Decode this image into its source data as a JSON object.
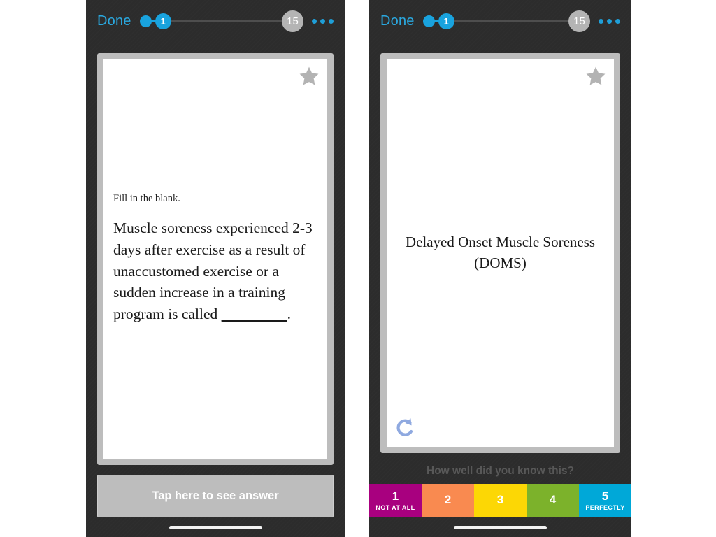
{
  "colors": {
    "panel_bg": "#2d2d2d",
    "accent_blue": "#19a3de",
    "done_blue": "#2aa8df",
    "card_border": "#bdbdbd",
    "tap_button_bg": "#bdbdbd",
    "star_gray": "#b3b3b3",
    "undo_blue": "#8fa9e0",
    "rating_1": "#a8007f",
    "rating_2": "#f98a50",
    "rating_3": "#fcd705",
    "rating_4": "#7cb22b",
    "rating_5": "#00a8d8"
  },
  "left_screen": {
    "topbar": {
      "done_label": "Done",
      "current_card": "1",
      "total_cards": "15",
      "more_icon": "ellipsis-icon"
    },
    "card": {
      "star_icon": "star-icon",
      "prompt": "Fill in the blank.",
      "question_before": "Muscle soreness experienced 2-3 days after exercise as a result of unaccustomed exercise or a sudden increase in a training program is called ",
      "question_blank": "________",
      "question_after": "."
    },
    "tap_button_label": "Tap here to see answer"
  },
  "right_screen": {
    "topbar": {
      "done_label": "Done",
      "current_card": "1",
      "total_cards": "15",
      "more_icon": "ellipsis-icon"
    },
    "card": {
      "star_icon": "star-icon",
      "undo_icon": "undo-arrow-icon",
      "answer_line_1": "Delayed Onset Muscle Soreness",
      "answer_line_2": "(DOMS)"
    },
    "rating": {
      "prompt": "How well did you know this?",
      "buttons": [
        {
          "number": "1",
          "sublabel": "NOT AT ALL",
          "color": "#a8007f"
        },
        {
          "number": "2",
          "sublabel": "",
          "color": "#f98a50"
        },
        {
          "number": "3",
          "sublabel": "",
          "color": "#fcd705"
        },
        {
          "number": "4",
          "sublabel": "",
          "color": "#7cb22b"
        },
        {
          "number": "5",
          "sublabel": "PERFECTLY",
          "color": "#00a8d8"
        }
      ]
    }
  }
}
